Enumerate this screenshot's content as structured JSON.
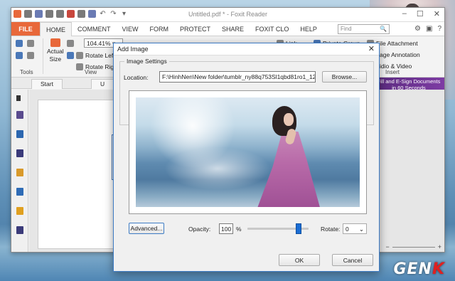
{
  "app": {
    "doc_title": "Untitled.pdf * - Foxit Reader"
  },
  "window_controls": {
    "minimize": "–",
    "restore": "☐",
    "close": "✕"
  },
  "qat": {
    "undo": "↶",
    "redo": "↷",
    "more": "▾"
  },
  "ribbon_tabs": {
    "file": "FILE",
    "items": [
      "HOME",
      "COMMENT",
      "VIEW",
      "FORM",
      "PROTECT",
      "SHARE",
      "FOXIT CLO",
      "HELP"
    ],
    "active": "HOME"
  },
  "find": {
    "placeholder": "Find",
    "icon": "🔍"
  },
  "ribbon": {
    "tools_label": "Tools",
    "view_label": "View",
    "insert_label": "Insert",
    "actual_size_line1": "Actual",
    "actual_size_line2": "Size",
    "zoom_value": "104.41%",
    "zoom_arrow": "▾",
    "rotate_left": "Rotate Lef",
    "rotate_right": "Rotate Rig",
    "link": "Link",
    "private_group": "Private Group",
    "file_attachment": "File Attachment",
    "image_annotation": "age Annotation",
    "audio_video": "idio & Video"
  },
  "doc_tabs": {
    "start": "Start",
    "second": "U"
  },
  "ad_banner": {
    "line1": "Fill and E-Sign Documents",
    "line2": "in 60 Seconds"
  },
  "status": {
    "minus": "−",
    "plus": "+"
  },
  "dialog": {
    "title": "Add Image",
    "close": "✕",
    "group_label": "Image Settings",
    "location_label": "Location:",
    "location_value": "F:\\HinhNen\\New folder\\tumblr_ny88q753Sl1qbd81ro1_128",
    "browse_label": "Browse...",
    "advanced_label": "Advanced...",
    "opacity_label": "Opacity:",
    "opacity_value": "100",
    "opacity_unit": "%",
    "opacity_level": 1.0,
    "rotate_label": "Rotate:",
    "rotate_value": "0",
    "ok_label": "OK",
    "cancel_label": "Cancel"
  },
  "watermark": {
    "prefix": "GEN",
    "suffix": "K"
  },
  "colors": {
    "accent": "#e8683a",
    "dialog_border": "#3d7bc4",
    "slider_thumb": "#1a6dd4"
  }
}
